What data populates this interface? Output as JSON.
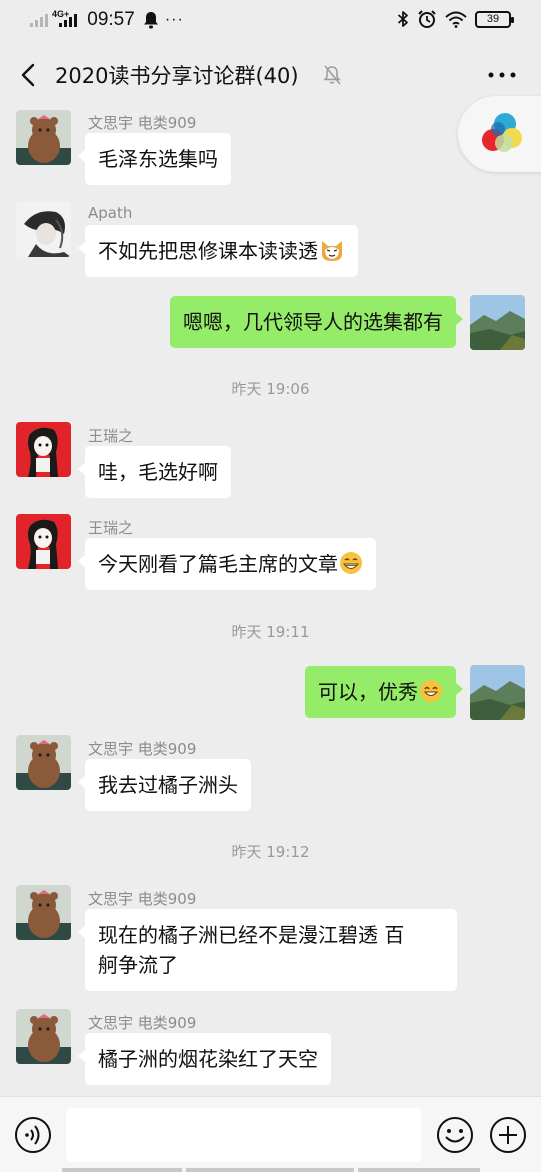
{
  "status_bar": {
    "network": "4G+",
    "time": "09:57",
    "more": "···",
    "battery": "39"
  },
  "header": {
    "title": "2020读书分享讨论群(40)",
    "back_icon": "chevron-left-icon",
    "mute_icon": "bell-muted-icon",
    "more_icon": "more-dots-icon"
  },
  "messages": [
    {
      "side": "in",
      "sender": "文思宇 电类909",
      "text": "毛泽东选集吗",
      "avatar": "brown-bear-avatar"
    },
    {
      "side": "in",
      "sender": "Apath",
      "text": "不如先把思修课本读读透",
      "emoji": "cat-face-emoji",
      "avatar": "sketch-girl-avatar"
    },
    {
      "side": "out",
      "text": "嗯嗯，几代领导人的选集都有",
      "avatar": "mountain-landscape-avatar"
    },
    {
      "time": "昨天 19:06"
    },
    {
      "side": "in",
      "sender": "王瑞之",
      "text": "哇，毛选好啊",
      "avatar": "red-cartoon-girl-avatar"
    },
    {
      "side": "in",
      "sender": "王瑞之",
      "text": "今天刚看了篇毛主席的文章",
      "emoji": "grinning-emoji",
      "avatar": "red-cartoon-girl-avatar"
    },
    {
      "time": "昨天 19:11"
    },
    {
      "side": "out",
      "text": "可以，优秀",
      "emoji": "smiling-emoji",
      "avatar": "mountain-landscape-avatar"
    },
    {
      "side": "in",
      "sender": "文思宇 电类909",
      "text": "我去过橘子洲头",
      "avatar": "brown-bear-avatar"
    },
    {
      "time": "昨天 19:12"
    },
    {
      "side": "in",
      "sender": "文思宇 电类909",
      "text_lines": [
        "现在的橘子洲已经不是漫江碧透 百",
        "舸争流了"
      ],
      "avatar": "brown-bear-avatar"
    },
    {
      "side": "in",
      "sender": "文思宇 电类909",
      "text": "橘子洲的烟花染红了天空",
      "avatar": "brown-bear-avatar"
    }
  ],
  "input_bar": {
    "value": "",
    "voice_icon": "voice-icon",
    "emoji_icon": "emoji-icon",
    "plus_icon": "plus-icon"
  },
  "colors": {
    "background": "#ededed",
    "outgoing_bubble": "#95ec69",
    "incoming_bubble": "#ffffff"
  }
}
